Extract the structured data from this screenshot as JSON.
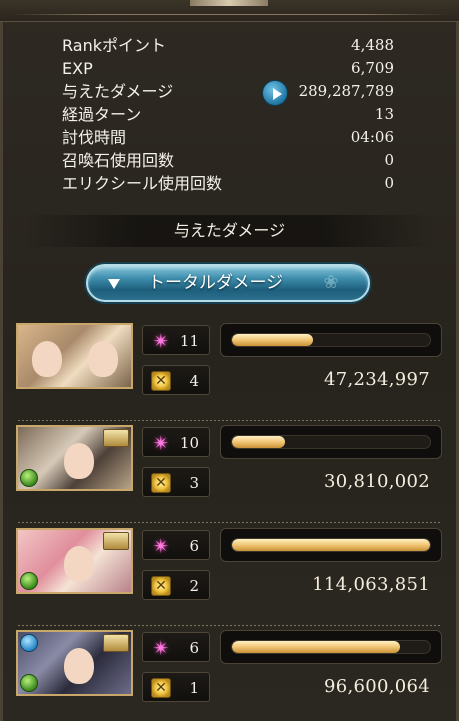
{
  "stats": [
    {
      "label": "Rankポイント",
      "value": "4,488"
    },
    {
      "label": "EXP",
      "value": "6,709"
    },
    {
      "label": "与えたダメージ",
      "value": "289,287,789"
    },
    {
      "label": "経過ターン",
      "value": "13"
    },
    {
      "label": "討伐時間",
      "value": "04:06"
    },
    {
      "label": "召喚石使用回数",
      "value": "0"
    },
    {
      "label": "エリクシール使用回数",
      "value": "0"
    }
  ],
  "section_title": "与えたダメージ",
  "total_button_label": "トータルダメージ",
  "members": [
    {
      "star_count": "11",
      "ougi_count": "4",
      "damage": "47,234,997",
      "damage_share": 0.41,
      "element": "none"
    },
    {
      "star_count": "10",
      "ougi_count": "3",
      "damage": "30,810,002",
      "damage_share": 0.27,
      "element": "wind"
    },
    {
      "star_count": "6",
      "ougi_count": "2",
      "damage": "114,063,851",
      "damage_share": 1.0,
      "element": "wind"
    },
    {
      "star_count": "6",
      "ougi_count": "1",
      "damage": "96,600,064",
      "damage_share": 0.85,
      "element": "wind"
    }
  ],
  "icons": {
    "play": "play-icon",
    "star": "sparkle-icon",
    "ougi": "ougi-icon",
    "element": "element-icon"
  },
  "colors": {
    "bar_fill": "#f0c575",
    "button": "#3f8fae"
  }
}
